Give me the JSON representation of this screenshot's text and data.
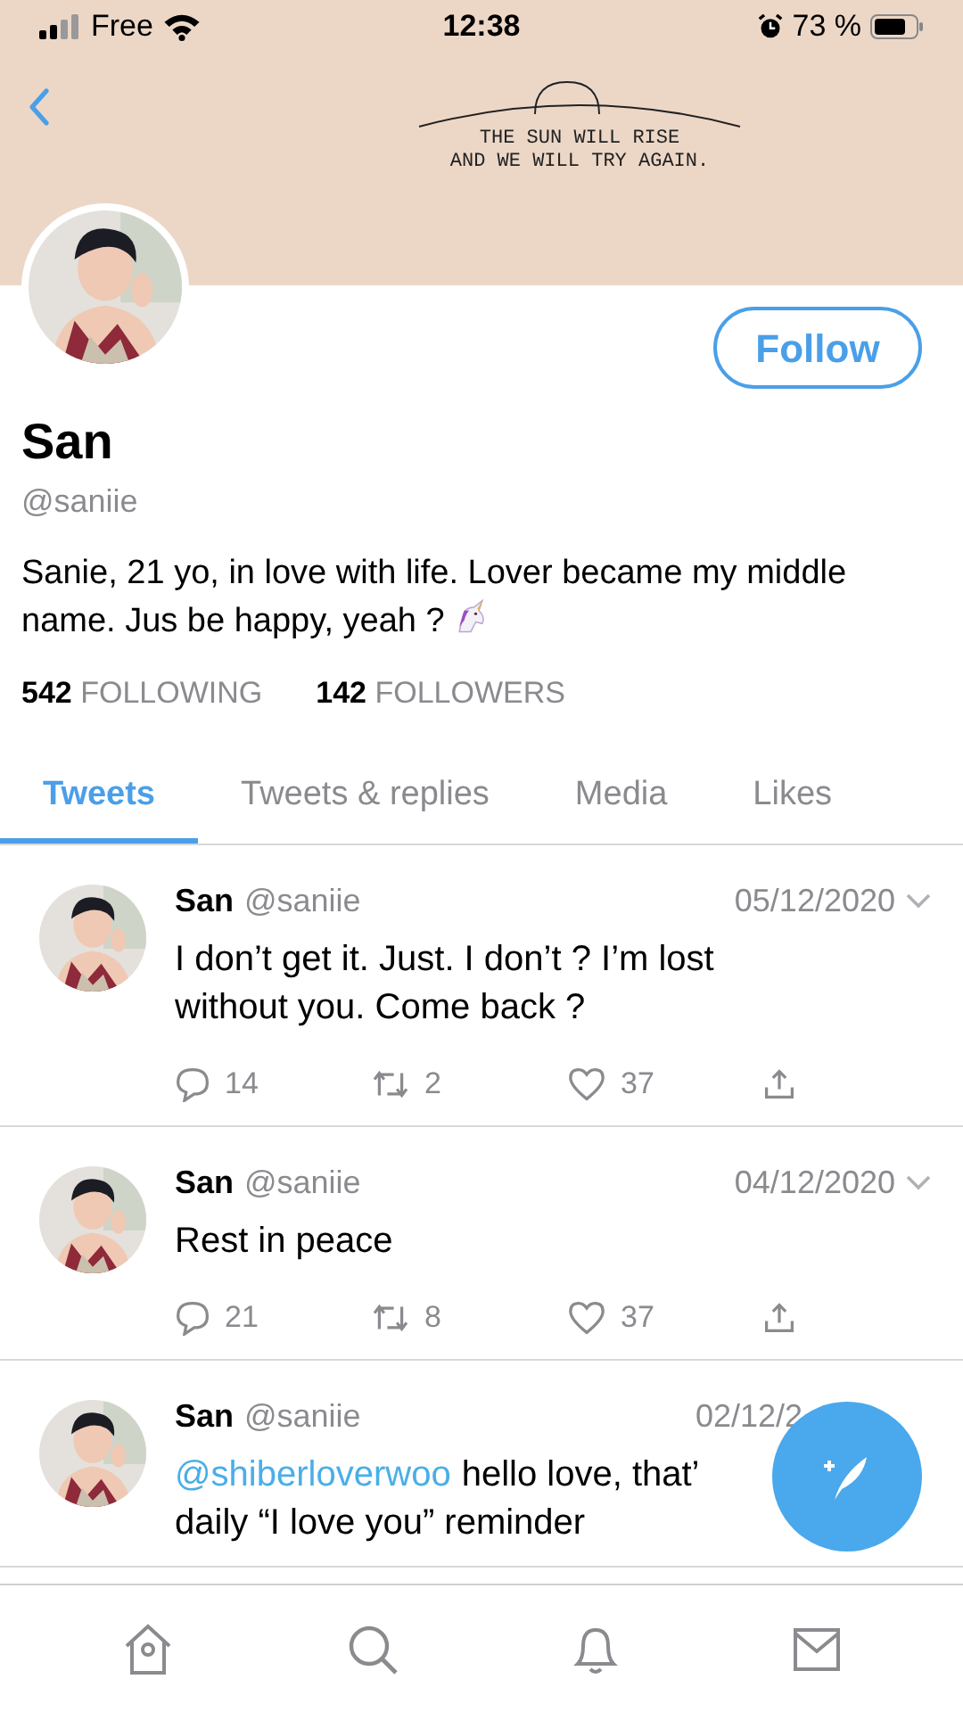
{
  "status_bar": {
    "carrier": "Free",
    "time": "12:38",
    "battery": "73 %"
  },
  "banner": {
    "lines": [
      "THE SUN WILL RISE",
      "AND WE WILL TRY AGAIN."
    ]
  },
  "profile": {
    "name": "San",
    "handle": "@saniie",
    "bio": "Sanie, 21 yo, in love with life. Lover became my middle name. Jus be happy, yeah ?",
    "follow_label": "Follow",
    "following_count": "542",
    "following_label": "FOLLOWING",
    "followers_count": "142",
    "followers_label": "FOLLOWERS"
  },
  "tabs": [
    {
      "label": "Tweets",
      "selected": true
    },
    {
      "label": "Tweets & replies",
      "selected": false
    },
    {
      "label": "Media",
      "selected": false
    },
    {
      "label": "Likes",
      "selected": false
    }
  ],
  "tweets": [
    {
      "name": "San",
      "handle": "@saniie",
      "date": "05/12/2020",
      "menu_caret": true,
      "lines": [
        "I don’t get it. Just. I don’t ? I’m lost",
        "without you. Come back ?"
      ],
      "replies": "14",
      "retweets": "2",
      "likes": "37"
    },
    {
      "name": "San",
      "handle": "@saniie",
      "date": "04/12/2020",
      "menu_caret": true,
      "lines": [
        "Rest in peace"
      ],
      "replies": "21",
      "retweets": "8",
      "likes": "37"
    },
    {
      "name": "San",
      "handle": "@saniie",
      "date": "02/12/2",
      "menu_caret": false,
      "mention": "@shiberloverwoo",
      "lines": [
        "hello love, that’",
        "daily “I love you” reminder"
      ]
    }
  ]
}
